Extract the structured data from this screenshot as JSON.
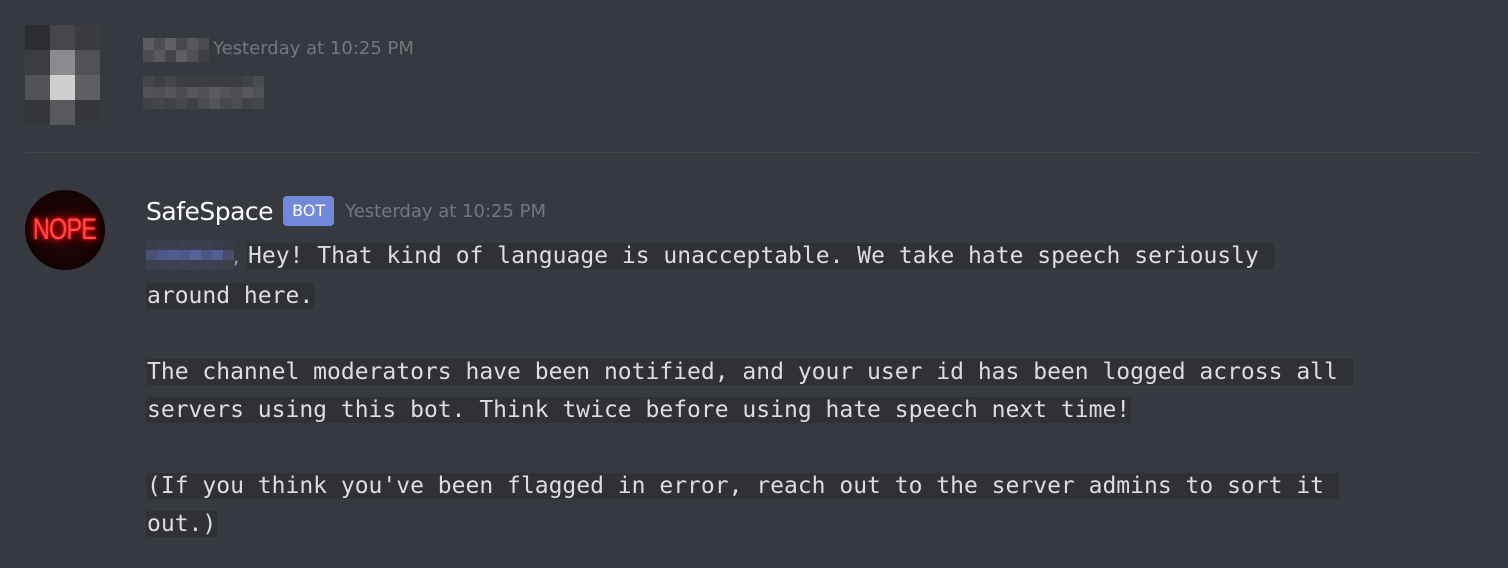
{
  "colors": {
    "background": "#36393f",
    "code_background": "#2f3136",
    "bot_badge": "#7289da",
    "timestamp": "#72767d",
    "divider": "#42454a",
    "nope_red": "#ff4a4a"
  },
  "messages": [
    {
      "author": "",
      "timestamp": "Yesterday at 10:25 PM",
      "avatar_icon": "pixelated-avatar-icon",
      "content_redacted": true
    },
    {
      "author": "SafeSpace",
      "badge": "BOT",
      "timestamp": "Yesterday at 10:25 PM",
      "avatar_text": "NOPE",
      "mention_suffix": ",",
      "lines": [
        "Hey! That kind of language is unacceptable. We take hate speech seriously ",
        "around here.",
        "The channel moderators have been notified, and your user id has been logged across all ",
        "servers using this bot. Think twice before using hate speech next time!",
        "(If you think you've been flagged in error, reach out to the server admins to sort it ",
        "out.)"
      ]
    }
  ]
}
